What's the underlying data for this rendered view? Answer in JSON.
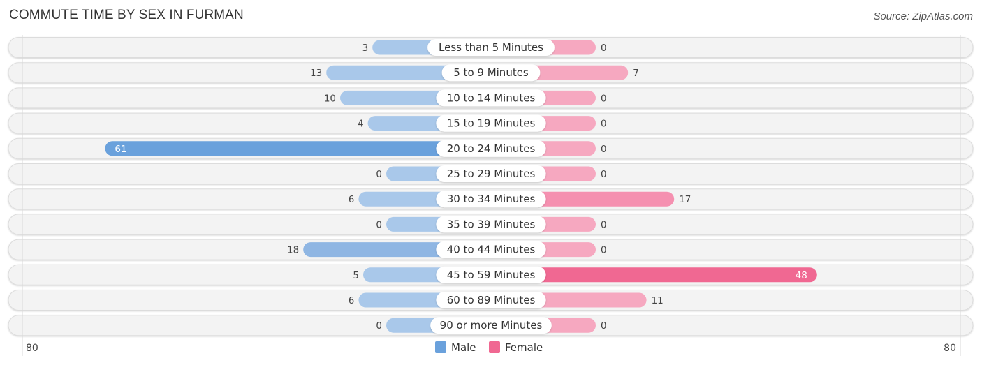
{
  "header": {
    "title": "COMMUTE TIME BY SEX IN FURMAN",
    "source": "Source: ZipAtlas.com"
  },
  "chart_data": {
    "type": "bar",
    "orientation": "horizontal-diverging",
    "title": "COMMUTE TIME BY SEX IN FURMAN",
    "categories": [
      "Less than 5 Minutes",
      "5 to 9 Minutes",
      "10 to 14 Minutes",
      "15 to 19 Minutes",
      "20 to 24 Minutes",
      "25 to 29 Minutes",
      "30 to 34 Minutes",
      "35 to 39 Minutes",
      "40 to 44 Minutes",
      "45 to 59 Minutes",
      "60 to 89 Minutes",
      "90 or more Minutes"
    ],
    "series": [
      {
        "name": "Male",
        "side": "left",
        "color": "#6aa1dc",
        "light_color": "#a9c8ea",
        "values": [
          3,
          13,
          10,
          4,
          61,
          0,
          6,
          0,
          18,
          5,
          6,
          0
        ]
      },
      {
        "name": "Female",
        "side": "right",
        "color": "#f06892",
        "light_color": "#f6a8c0",
        "values": [
          0,
          7,
          0,
          0,
          0,
          0,
          17,
          0,
          0,
          48,
          11,
          0
        ]
      }
    ],
    "axis": {
      "left_label": "80",
      "right_label": "80",
      "range": [
        0,
        80
      ]
    },
    "legend": {
      "position": "bottom-center",
      "items": [
        "Male",
        "Female"
      ]
    },
    "grid": false
  }
}
